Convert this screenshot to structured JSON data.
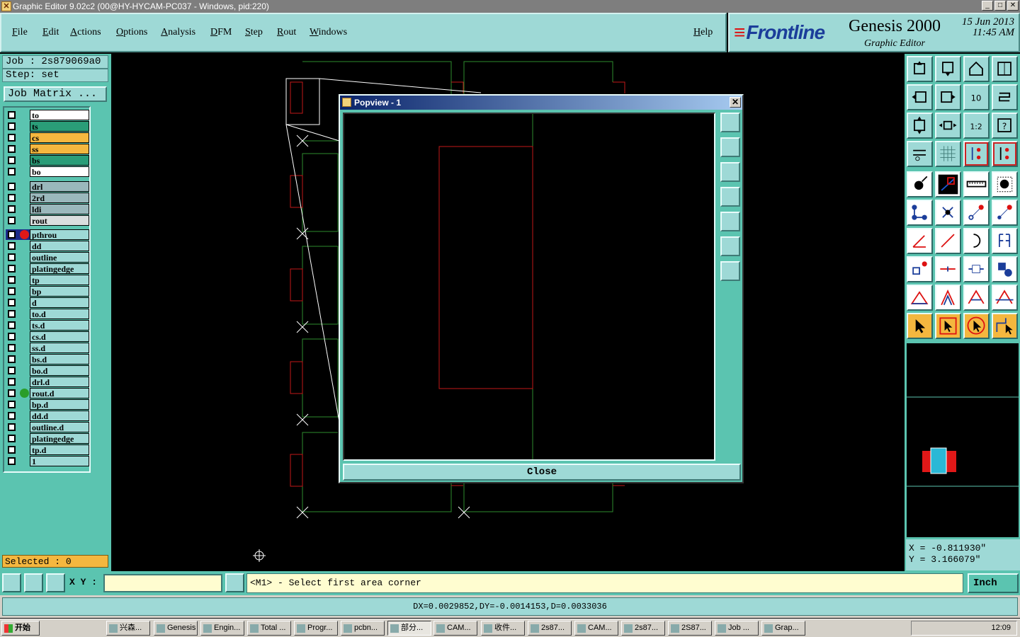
{
  "window": {
    "title": "Graphic Editor 9.02c2 (00@HY-HYCAM-PC037 - Windows, pid:220)"
  },
  "menu": [
    "File",
    "Edit",
    "Actions",
    "Options",
    "Analysis",
    "DFM",
    "Step",
    "Rout",
    "Windows"
  ],
  "help_label": "Help",
  "logo": {
    "brand": "Frontline",
    "product": "Genesis 2000",
    "subtitle": "Graphic Editor",
    "date": "15 Jun 2013",
    "time": "11:45 AM"
  },
  "job": {
    "label": "Job : 2s879069a0",
    "step": "Step: set",
    "matrix_button": "Job Matrix ..."
  },
  "layers": [
    {
      "name": "to",
      "color": "#ffffff"
    },
    {
      "name": "ts",
      "color": "#2a9d78"
    },
    {
      "name": "cs",
      "color": "#f4b73f"
    },
    {
      "name": "ss",
      "color": "#f4b73f"
    },
    {
      "name": "bs",
      "color": "#2a9d78"
    },
    {
      "name": "bo",
      "color": "#ffffff"
    },
    {
      "name": "drl",
      "color": "#9ab8bc"
    },
    {
      "name": "2rd",
      "color": "#9ab8bc"
    },
    {
      "name": "ldi",
      "color": "#9ab8bc"
    },
    {
      "name": "rout",
      "color": "#d9dede"
    },
    {
      "name": "pthrou",
      "color": "#9ed9d6",
      "indicator": "#e01818"
    },
    {
      "name": "dd",
      "color": "#9ed9d6"
    },
    {
      "name": "outline",
      "color": "#9ed9d6"
    },
    {
      "name": "platingedge",
      "color": "#9ed9d6"
    },
    {
      "name": "tp",
      "color": "#9ed9d6"
    },
    {
      "name": "bp",
      "color": "#9ed9d6"
    },
    {
      "name": "d",
      "color": "#9ed9d6"
    },
    {
      "name": "to.d",
      "color": "#9ed9d6"
    },
    {
      "name": "ts.d",
      "color": "#9ed9d6"
    },
    {
      "name": "cs.d",
      "color": "#9ed9d6"
    },
    {
      "name": "ss.d",
      "color": "#9ed9d6"
    },
    {
      "name": "bs.d",
      "color": "#9ed9d6"
    },
    {
      "name": "bo.d",
      "color": "#9ed9d6"
    },
    {
      "name": "drl.d",
      "color": "#9ed9d6"
    },
    {
      "name": "rout.d",
      "color": "#9ed9d6",
      "indicator": "#2a9d2a"
    },
    {
      "name": "bp.d",
      "color": "#9ed9d6"
    },
    {
      "name": "dd.d",
      "color": "#9ed9d6"
    },
    {
      "name": "outline.d",
      "color": "#9ed9d6"
    },
    {
      "name": "platingedge",
      "color": "#9ed9d6"
    },
    {
      "name": "tp.d",
      "color": "#9ed9d6"
    },
    {
      "name": "1",
      "color": "#9ed9d6"
    }
  ],
  "selected": "Selected : 0",
  "popview": {
    "title": "Popview - 1",
    "close_label": "Close"
  },
  "coords": {
    "x": "X = -0.811930\"",
    "y": "Y = 3.166079\""
  },
  "cmd": {
    "xy_label": "X Y :",
    "xy_value": "",
    "prompt": "<M1> - Select first area corner",
    "units": "Inch"
  },
  "status": "DX=0.0029852,DY=-0.0014153,D=0.0033036",
  "taskbar": {
    "start": "开始",
    "tasks": [
      "兴森...",
      "Genesis",
      "Engin...",
      "Total ...",
      "Progr...",
      "pcbn...",
      "部分...",
      "CAM...",
      "收件...",
      "2s87...",
      "CAM...",
      "2s87...",
      "2S87...",
      "Job ...",
      "Grap..."
    ],
    "active_task": 6,
    "clock": "12:09"
  }
}
